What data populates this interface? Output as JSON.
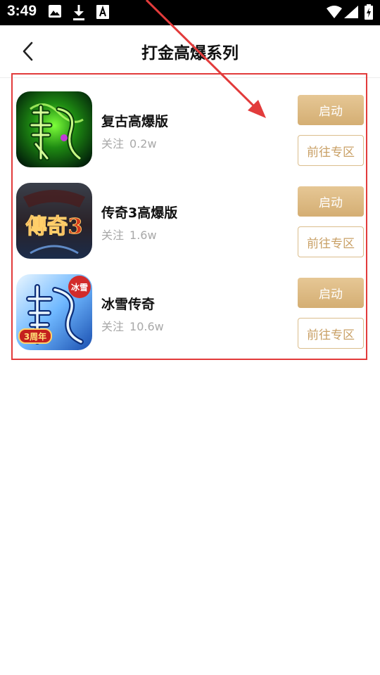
{
  "status_bar": {
    "time": "3:49",
    "icons": [
      "image-icon",
      "download-icon",
      "font-a-icon",
      "wifi-icon",
      "signal-icon",
      "battery-icon"
    ]
  },
  "header": {
    "title": "打金高爆系列",
    "back_icon": "chevron-left-icon"
  },
  "games": [
    {
      "name": "复古高爆版",
      "follow_label": "关注",
      "follow_count": "0.2w",
      "launch_label": "启动",
      "zone_label": "前往专区",
      "icon": "dragon-green-game-icon"
    },
    {
      "name": "传奇3高爆版",
      "follow_label": "关注",
      "follow_count": "1.6w",
      "launch_label": "启动",
      "zone_label": "前往专区",
      "icon": "legend3-game-icon"
    },
    {
      "name": "冰雪传奇",
      "follow_label": "关注",
      "follow_count": "10.6w",
      "launch_label": "启动",
      "zone_label": "前往专区",
      "icon": "ice-dragon-game-icon"
    }
  ],
  "icon_texts": {
    "legend3_logo": "傳奇3",
    "ice_badge": "冰雪",
    "ice_anniversary": "3周年"
  },
  "colors": {
    "accent_gold": "#d9b47a",
    "annotation_red": "#e23b3b",
    "status_bar_bg": "#000000"
  }
}
